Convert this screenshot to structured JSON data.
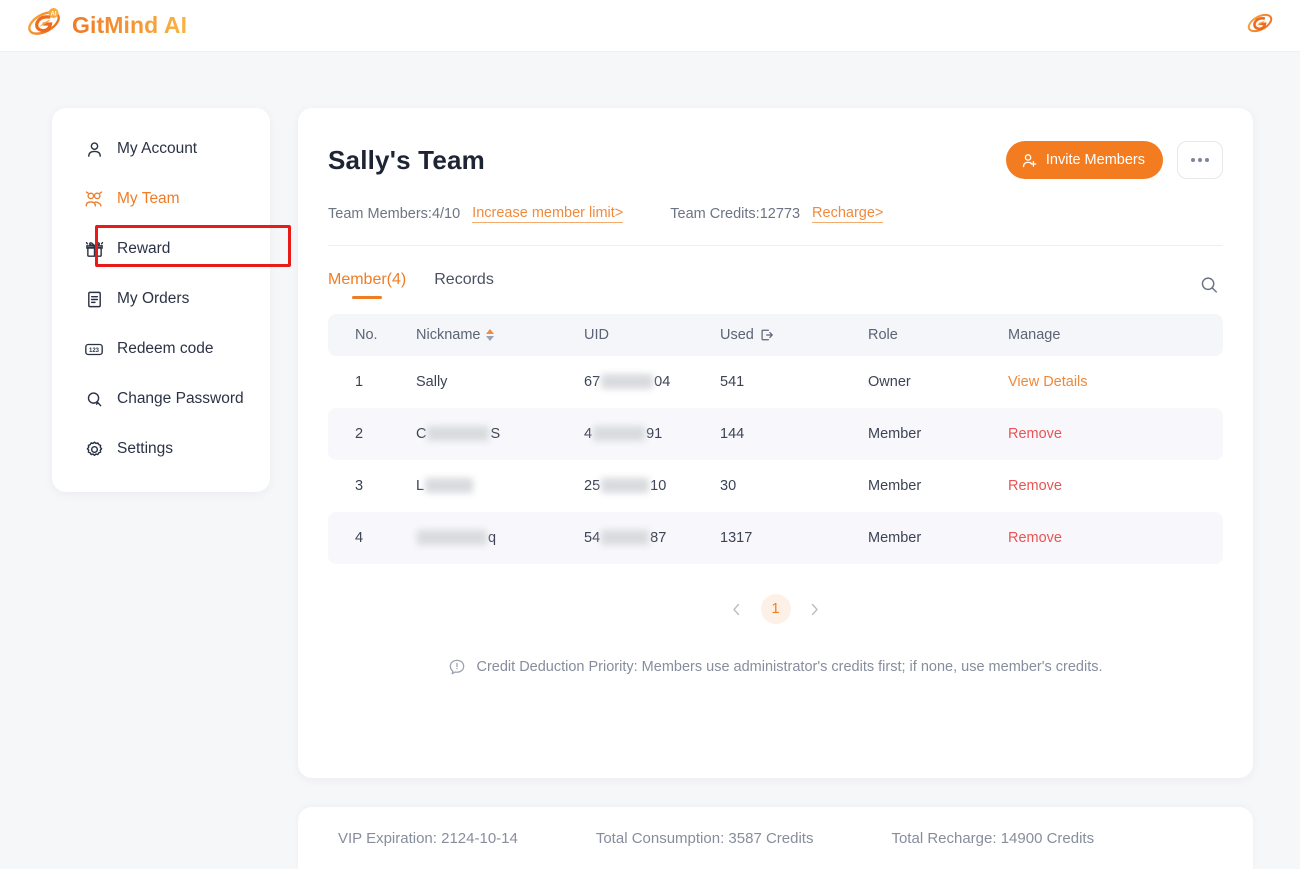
{
  "app": {
    "brand_name": "GitMind AI",
    "logo_icon": "gitmind-logo-icon",
    "top_right_logo_icon": "gitmind-mark-icon"
  },
  "sidebar": {
    "items": [
      {
        "label": "My Account",
        "icon": "user-icon",
        "active": false
      },
      {
        "label": "My Team",
        "icon": "team-icon",
        "active": true
      },
      {
        "label": "Reward",
        "icon": "gift-icon",
        "active": false
      },
      {
        "label": "My Orders",
        "icon": "document-icon",
        "active": false
      },
      {
        "label": "Redeem code",
        "icon": "numbers-123-icon",
        "active": false
      },
      {
        "label": "Change Password",
        "icon": "search-key-icon",
        "active": false
      },
      {
        "label": "Settings",
        "icon": "gear-icon",
        "active": false
      }
    ]
  },
  "main": {
    "title": "Sally's Team",
    "invite_button": "Invite Members",
    "invite_icon": "user-plus-icon",
    "more_button_icon": "ellipsis-icon",
    "meta": {
      "members_label": "Team Members:4/10",
      "members_link": "Increase member limit>",
      "credits_label": "Team Credits:12773",
      "credits_link": "Recharge>"
    },
    "tabs": [
      {
        "label": "Member(4)",
        "active": true
      },
      {
        "label": "Records",
        "active": false
      }
    ],
    "search_icon": "search-icon",
    "table": {
      "columns": [
        {
          "label": "No.",
          "icon": null
        },
        {
          "label": "Nickname",
          "icon": "sort-icon"
        },
        {
          "label": "UID",
          "icon": null
        },
        {
          "label": "Used",
          "icon": "export-icon"
        },
        {
          "label": "Role",
          "icon": null
        },
        {
          "label": "Manage",
          "icon": null
        }
      ],
      "rows": [
        {
          "no": "1",
          "nickname": "Sally",
          "nickname_redacted": false,
          "uid_prefix": "67",
          "uid_suffix": "04",
          "uid_redact_width": 52,
          "used": "541",
          "role": "Owner",
          "manage": "View Details",
          "manage_type": "view"
        },
        {
          "no": "2",
          "nickname_prefix": "C",
          "nickname_suffix": "S",
          "nickname_redacted": true,
          "nickname_redact_width": 62,
          "uid_prefix": "4",
          "uid_suffix": "91",
          "uid_redact_width": 52,
          "used": "144",
          "role": "Member",
          "manage": "Remove",
          "manage_type": "remove"
        },
        {
          "no": "3",
          "nickname_prefix": "L",
          "nickname_suffix": "",
          "nickname_redacted": true,
          "nickname_redact_width": 48,
          "uid_prefix": "25",
          "uid_suffix": "10",
          "uid_redact_width": 48,
          "used": "30",
          "role": "Member",
          "manage": "Remove",
          "manage_type": "remove"
        },
        {
          "no": "4",
          "nickname_prefix": "",
          "nickname_suffix": "q",
          "nickname_redacted": true,
          "nickname_redact_width": 70,
          "uid_prefix": "54",
          "uid_suffix": "87",
          "uid_redact_width": 48,
          "used": "1317",
          "role": "Member",
          "manage": "Remove",
          "manage_type": "remove"
        }
      ]
    },
    "pagination": {
      "prev_icon": "chevron-left-icon",
      "next_icon": "chevron-right-icon",
      "current_page": "1"
    },
    "note": {
      "icon": "info-exclamation-icon",
      "text": "Credit Deduction Priority: Members use administrator's credits first; if none, use member's credits."
    }
  },
  "footer": {
    "vip_expiration": "VIP Expiration: 2124-10-14",
    "total_consumption": "Total Consumption: 3587 Credits",
    "total_recharge": "Total Recharge: 14900 Credits"
  },
  "annotations": [
    {
      "name": "my-team-highlight",
      "color": "#e81b18"
    },
    {
      "name": "view-details-highlight",
      "color": "#e81b18"
    }
  ],
  "colors": {
    "brand_orange": "#f47c20",
    "link_orange": "#f08a3c",
    "remove_red": "#ea5455",
    "annotation_red": "#e81b18",
    "page_bg": "#f6f7f9",
    "row_alt_bg": "#f8f8fc",
    "table_head_bg": "#f5f6fa"
  }
}
